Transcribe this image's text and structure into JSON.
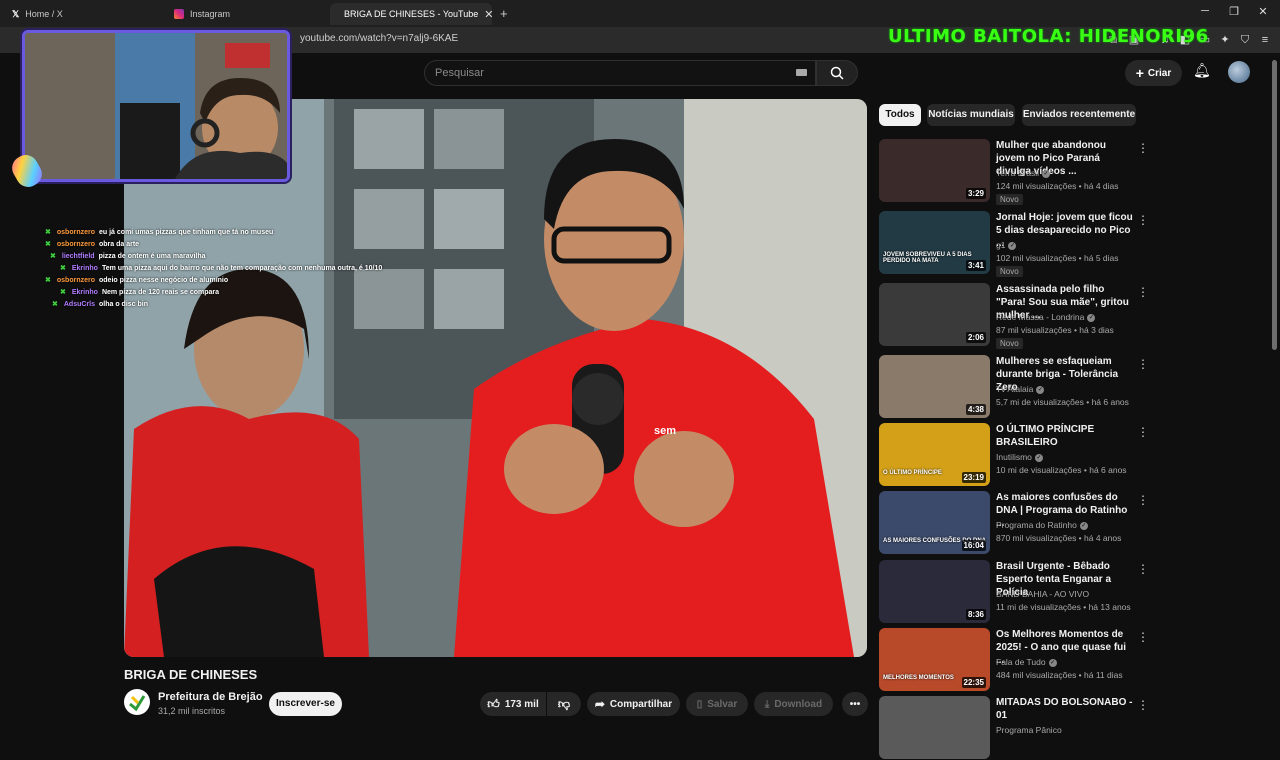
{
  "browser": {
    "tabs": [
      {
        "label": "Home / X",
        "active": false
      },
      {
        "label": "Instagram",
        "active": false
      },
      {
        "label": "BRIGA DE CHINESES - YouTube",
        "active": true
      }
    ],
    "url": "youtube.com/watch?v=n7alj9-6KAE"
  },
  "stream_overlay": {
    "banner": "ULTIMO BAITOLA: HIDENORI96",
    "chat": [
      {
        "user": "osbornzero",
        "color": "#ff9a3c",
        "message": "eu já comi umas pizzas que tinham que tá no museu"
      },
      {
        "user": "osbornzero",
        "color": "#ff9a3c",
        "message": "obra da arte"
      },
      {
        "user": "liechtfield",
        "color": "#b07cff",
        "message": "pizza de ontem é uma maravilha"
      },
      {
        "user": "Ekrinho",
        "color": "#b07cff",
        "message": "Tem uma pizza aqui do bairro que não tem comparação com nenhuma outra, é 10/10"
      },
      {
        "user": "osbornzero",
        "color": "#ff9a3c",
        "message": "odeio pizza nesse negócio de alumínio"
      },
      {
        "user": "Ekrinho",
        "color": "#b07cff",
        "message": "Nem pizza de 120 reais se compara"
      },
      {
        "user": "AdsuCrls",
        "color": "#b07cff",
        "message": "olha o disc bin"
      }
    ]
  },
  "header": {
    "search_placeholder": "Pesquisar",
    "create_label": "Criar"
  },
  "video": {
    "title": "BRIGA DE CHINESES",
    "channel": "Prefeitura de Brejão",
    "subscribers": "31,2 mil inscritos",
    "subscribe_label": "Inscrever-se",
    "likes": "173 mil",
    "share_label": "Compartilhar",
    "save_label": "Salvar",
    "download_label": "Download"
  },
  "chips": [
    "Todos",
    "Notícias mundiais",
    "Enviados recentemente"
  ],
  "recommendations": [
    {
      "title": "Mulher que abandonou jovem no Pico Paraná divulga vídeos ...",
      "channel": "Terra Brasil",
      "meta": "124 mil visualizações • há 4 dias",
      "duration": "3:29",
      "badge": "Novo",
      "verified": true
    },
    {
      "title": "Jornal Hoje: jovem que ficou 5 dias desaparecido no Pico ...",
      "channel": "g1",
      "meta": "102 mil visualizações • há 5 dias",
      "duration": "3:41",
      "badge": "Novo",
      "verified": true
    },
    {
      "title": "Assassinada pelo filho \"Para! Sou sua mãe\", gritou mulher ...",
      "channel": "Rede Massa - Londrina",
      "meta": "87 mil visualizações • há 3 dias",
      "duration": "2:06",
      "badge": "Novo",
      "verified": true
    },
    {
      "title": "Mulheres se esfaqueiam durante briga - Tolerância Zero",
      "channel": "Tv Atalaia",
      "meta": "5,7 mi de visualizações • há 6 anos",
      "duration": "4:38",
      "badge": "",
      "verified": true
    },
    {
      "title": "O ÚLTIMO PRÍNCIPE BRASILEIRO",
      "channel": "Inutilismo",
      "meta": "10 mi de visualizações • há 6 anos",
      "duration": "23:19",
      "badge": "",
      "verified": true
    },
    {
      "title": "As maiores confusões do DNA | Programa do Ratinho ...",
      "channel": "Programa do Ratinho",
      "meta": "870 mil visualizações • há 4 anos",
      "duration": "16:04",
      "badge": "",
      "verified": true
    },
    {
      "title": "Brasil Urgente -  Bêbado Esperto tenta Enganar a Polícia",
      "channel": "BAND BAHIA - AO VIVO",
      "meta": "11 mi de visualizações • há 13 anos",
      "duration": "8:36",
      "badge": "",
      "verified": false
    },
    {
      "title": "Os Melhores Momentos de 2025! - O ano que quase fui ...",
      "channel": "Fala de Tudo",
      "meta": "484 mil visualizações • há 11 dias",
      "duration": "22:35",
      "badge": "",
      "verified": true
    },
    {
      "title": "MITADAS DO BOLSONABO - 01",
      "channel": "Programa Pânico",
      "meta": "",
      "duration": "",
      "badge": "",
      "verified": false
    }
  ],
  "thumb_colors": [
    "#3b2a2a",
    "#223a44",
    "#3a3a3a",
    "#8a7a6a",
    "#d4a017",
    "#3b4a6a",
    "#2a2a3a",
    "#b84a2a",
    "#5a5a5a"
  ],
  "overlay_thumb_text": [
    "",
    "JOVEM SOBREVIVEU A 5 DIAS PERDIDO NA MATA",
    "",
    "",
    "O ÚLTIMO PRÍNCIPE",
    "AS MAIORES CONFUSÕES DO DNA",
    "",
    "MELHORES MOMENTOS",
    ""
  ]
}
